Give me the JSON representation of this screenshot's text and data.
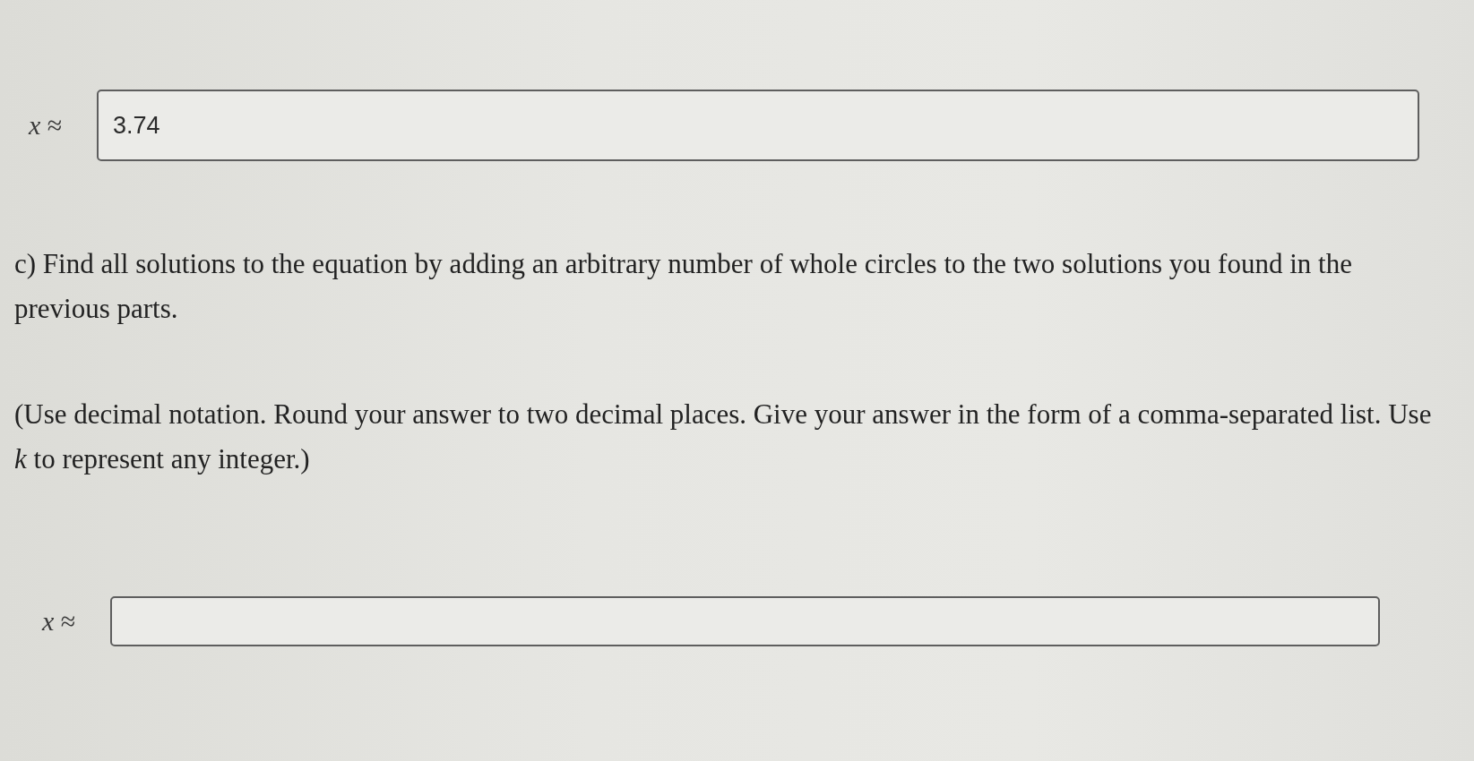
{
  "part_b": {
    "answer": {
      "label": "*x* ≈",
      "value": "3.74"
    }
  },
  "part_c": {
    "question": "c) Find all solutions to the equation by adding an arbitrary number of whole circles to the two solutions you found in the previous parts.",
    "instructions": "(Use decimal notation. Round your answer to two decimal places. Give your answer in the form of a comma-separated list. Use *k* to represent any integer.)",
    "answer": {
      "label": "*x* ≈"
    }
  }
}
